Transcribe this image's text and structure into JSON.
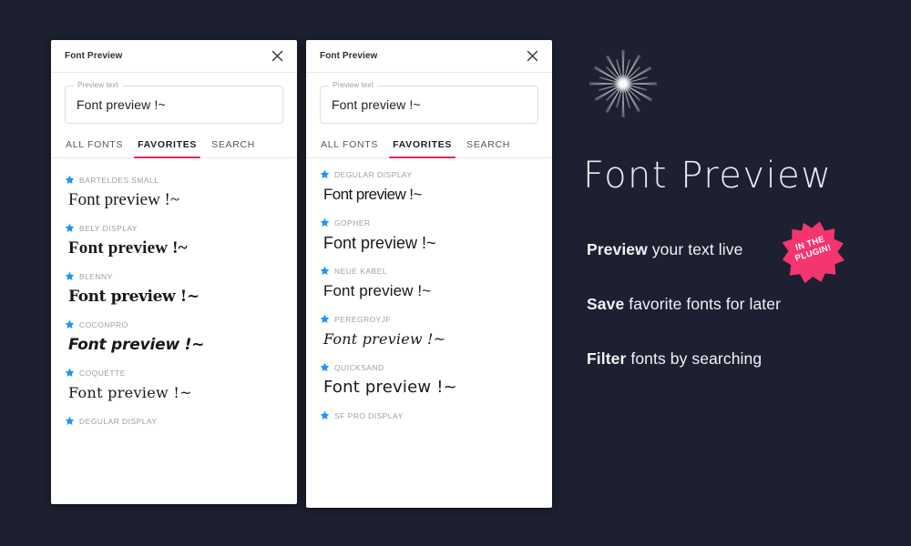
{
  "theme": {
    "background": "#1d2030",
    "panel_background": "#ffffff",
    "accent": "#e0285a",
    "star_color": "#2196f3",
    "badge_color": "#f5356e"
  },
  "panels": [
    {
      "title": "Font Preview",
      "close_icon": "close-icon",
      "preview_field": {
        "legend": "Preview text",
        "value": "Font preview !~",
        "placeholder": "Preview text"
      },
      "tabs": [
        {
          "label": "ALL FONTS",
          "active": false
        },
        {
          "label": "FAVORITES",
          "active": true
        },
        {
          "label": "SEARCH",
          "active": false
        }
      ],
      "fonts": [
        {
          "name": "BARTELDES SMALL",
          "sample": "Font preview !~",
          "favorited": true
        },
        {
          "name": "BELY DISPLAY",
          "sample": "Font preview !~",
          "favorited": true
        },
        {
          "name": "BLENNY",
          "sample": "Font preview !~",
          "favorited": true
        },
        {
          "name": "COCONPRO",
          "sample": "Font preview !~",
          "favorited": true
        },
        {
          "name": "COQUETTE",
          "sample": "Font preview !~",
          "favorited": true
        },
        {
          "name": "DEGULAR DISPLAY",
          "sample": "",
          "favorited": true
        }
      ]
    },
    {
      "title": "Font Preview",
      "close_icon": "close-icon",
      "preview_field": {
        "legend": "Preview text",
        "value": "Font preview !~",
        "placeholder": "Preview text"
      },
      "tabs": [
        {
          "label": "ALL FONTS",
          "active": false
        },
        {
          "label": "FAVORITES",
          "active": true
        },
        {
          "label": "SEARCH",
          "active": false
        }
      ],
      "fonts": [
        {
          "name": "DEGULAR DISPLAY",
          "sample": "Font preview !~",
          "favorited": true
        },
        {
          "name": "GOPHER",
          "sample": "Font preview !~",
          "favorited": true
        },
        {
          "name": "NEUE KABEL",
          "sample": "Font preview !~",
          "favorited": true
        },
        {
          "name": "PEREGROYJF",
          "sample": "Font preview !~",
          "favorited": true
        },
        {
          "name": "QUICKSAND",
          "sample": "Font preview !~",
          "favorited": true
        },
        {
          "name": "SF PRO DISPLAY",
          "sample": "",
          "favorited": true
        }
      ]
    }
  ],
  "promo": {
    "logo_icon": "starburst-sparkle-icon",
    "wordmark": "Font Preview",
    "features": [
      {
        "strong": "Preview",
        "rest": " your text live"
      },
      {
        "strong": "Save",
        "rest": " favorite fonts for later"
      },
      {
        "strong": "Filter",
        "rest": " fonts by searching"
      }
    ],
    "badge": {
      "line1": "IN THE",
      "line2": "PLUGIN!"
    }
  }
}
